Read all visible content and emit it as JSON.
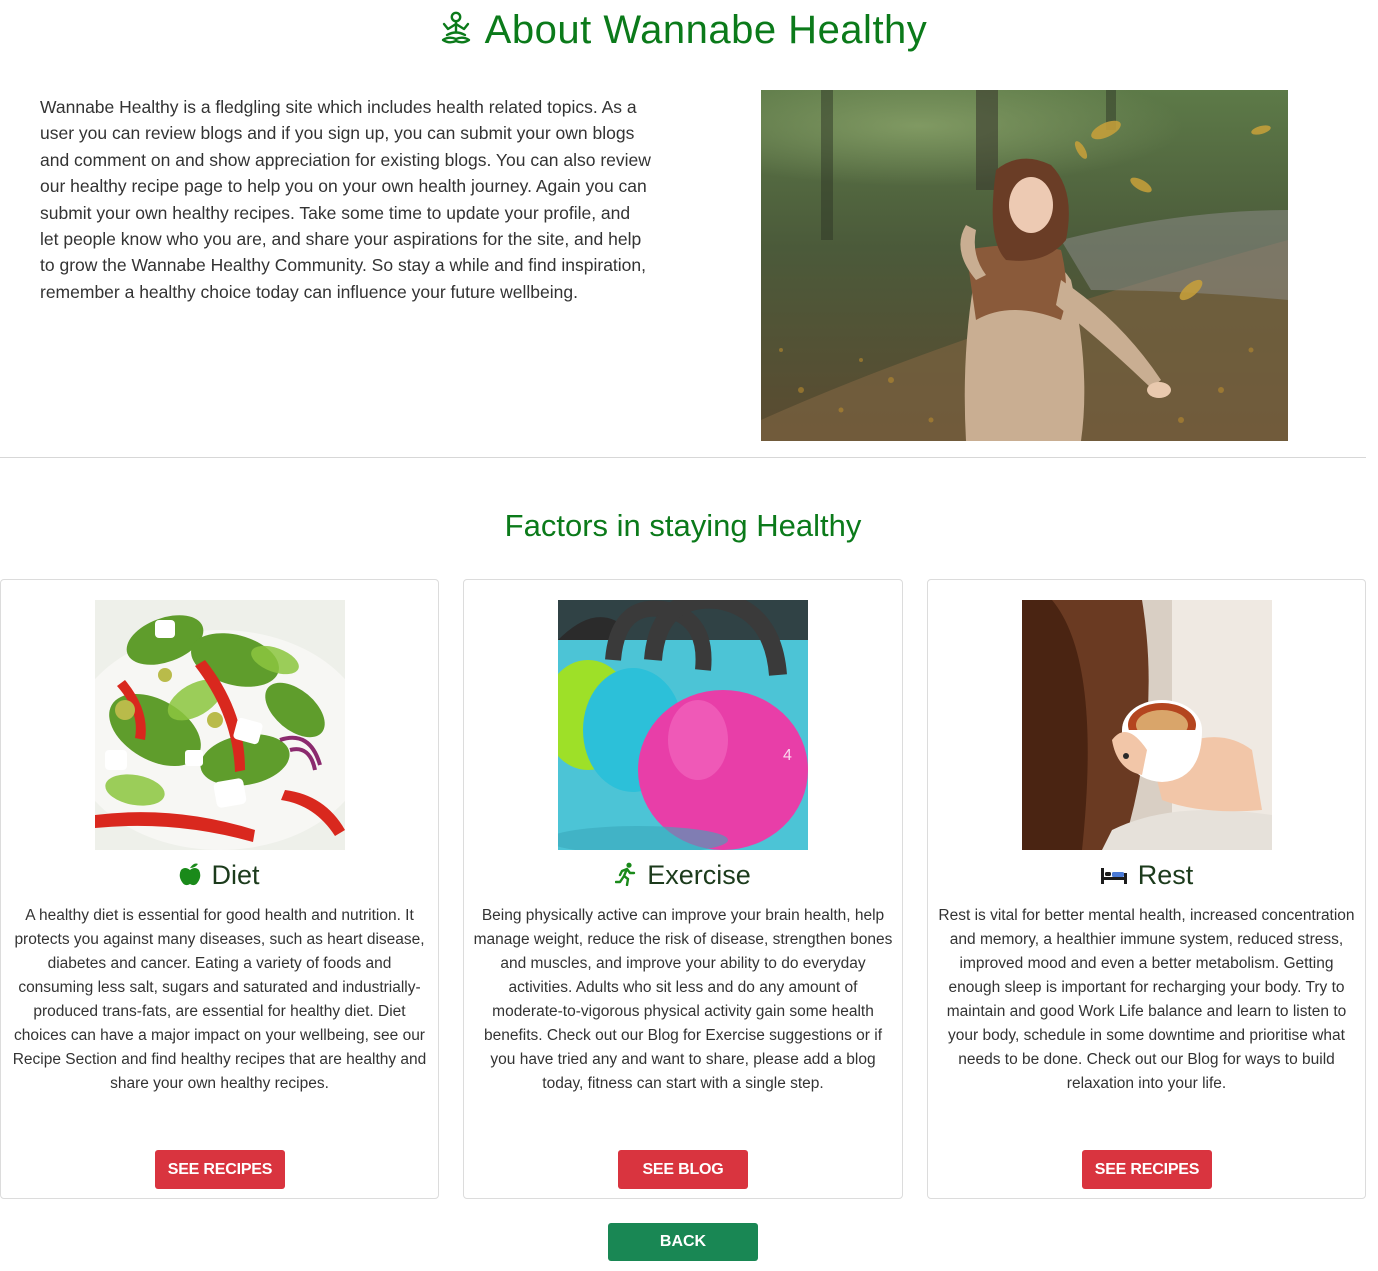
{
  "about": {
    "title": "About Wannabe Healthy",
    "title_icon": "meditation-icon",
    "paragraph": "Wannabe Healthy is a fledgling site which includes health related topics. As a user you can review blogs and if you sign up, you can submit your own blogs and comment on and show appreciation for existing blogs. You can also review our healthy recipe page to help you on your own health journey. Again you can submit your own healthy recipes. Take some time to update your profile, and let people know who you are, and share your aspirations for the site, and help to grow the Wannabe Healthy Community. So stay a while and find inspiration, remember a healthy choice today can influence your future wellbeing.",
    "hero_image": "woman-in-autumn-leaves-photo"
  },
  "factors": {
    "title": "Factors in staying Healthy",
    "cards": [
      {
        "icon": "apple-icon",
        "heading": "Diet",
        "image": "salad-photo",
        "text": "A healthy diet is essential for good health and nutrition. It protects you against many diseases, such as heart disease, diabetes and cancer. Eating a variety of foods and consuming less salt, sugars and saturated and industrially-produced trans-fats, are essential for healthy diet. Diet choices can have a major impact on your wellbeing, see our Recipe Section and find healthy recipes that are healthy and share your own healthy recipes.",
        "button": "SEE RECIPES"
      },
      {
        "icon": "running-person-icon",
        "heading": "Exercise",
        "image": "kettlebells-photo",
        "text": "Being physically active can improve your brain health, help manage weight, reduce the risk of disease, strengthen bones and muscles, and improve your ability to do everyday activities. Adults who sit less and do any amount of moderate-to-vigorous physical activity gain some health benefits. Check out our Blog for Exercise suggestions or if you have tried any and want to share, please add a blog today, fitness can start with a single step.",
        "button": "SEE BLOG"
      },
      {
        "icon": "bed-icon",
        "heading": "Rest",
        "image": "coffee-cup-photo",
        "text": "Rest is vital for better mental health, increased concentration and memory, a healthier immune system, reduced stress, improved mood and even a better metabolism. Getting enough sleep is important for recharging your body. Try to maintain and good Work Life balance and learn to listen to your body, schedule in some downtime and prioritise what needs to be done. Check out our Blog for ways to build relaxation into your life.",
        "button": "SEE RECIPES"
      }
    ]
  },
  "back_button": "BACK",
  "colors": {
    "heading_green": "#0b7a1a",
    "button_red": "#d9343f",
    "button_green": "#198754"
  }
}
